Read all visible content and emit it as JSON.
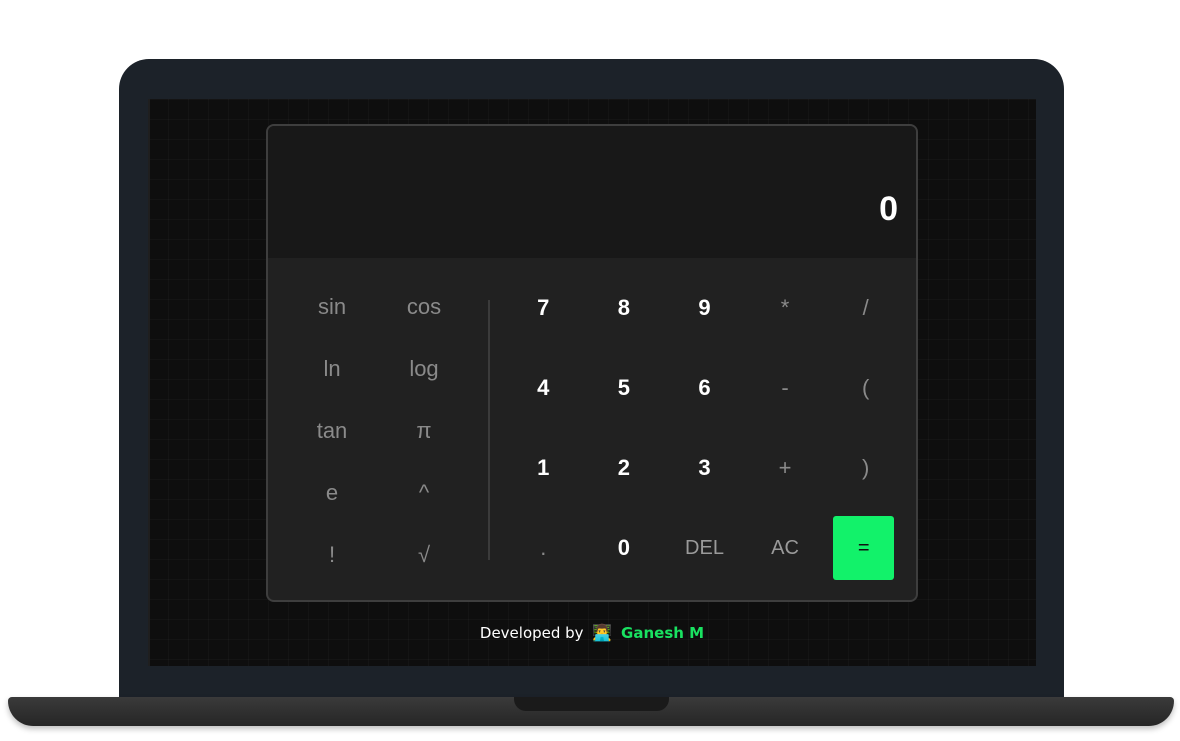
{
  "display": {
    "value": "0"
  },
  "scientific_keys": [
    "sin",
    "cos",
    "ln",
    "log",
    "tan",
    "π",
    "e",
    "^",
    "!",
    "√"
  ],
  "keypad": {
    "rows": [
      [
        {
          "label": "7",
          "kind": "num"
        },
        {
          "label": "8",
          "kind": "num"
        },
        {
          "label": "9",
          "kind": "num"
        },
        {
          "label": "*",
          "kind": "op"
        },
        {
          "label": "/",
          "kind": "op"
        }
      ],
      [
        {
          "label": "4",
          "kind": "num"
        },
        {
          "label": "5",
          "kind": "num"
        },
        {
          "label": "6",
          "kind": "num"
        },
        {
          "label": "-",
          "kind": "op"
        },
        {
          "label": "(",
          "kind": "op"
        }
      ],
      [
        {
          "label": "1",
          "kind": "num"
        },
        {
          "label": "2",
          "kind": "num"
        },
        {
          "label": "3",
          "kind": "num"
        },
        {
          "label": "+",
          "kind": "op"
        },
        {
          "label": ")",
          "kind": "op"
        }
      ],
      [
        {
          "label": ".",
          "kind": "op"
        },
        {
          "label": "0",
          "kind": "num"
        },
        {
          "label": "DEL",
          "kind": "func"
        },
        {
          "label": "AC",
          "kind": "func"
        },
        {
          "label": "=",
          "kind": "equals"
        }
      ]
    ]
  },
  "footer": {
    "prefix": "Developed by",
    "icon": "technologist-emoji",
    "author": "Ganesh M"
  },
  "colors": {
    "accent": "#12f26a",
    "author": "#19e261",
    "display_bg": "#181818",
    "panel_bg": "#212121",
    "laptop_frame": "#1c2229"
  }
}
